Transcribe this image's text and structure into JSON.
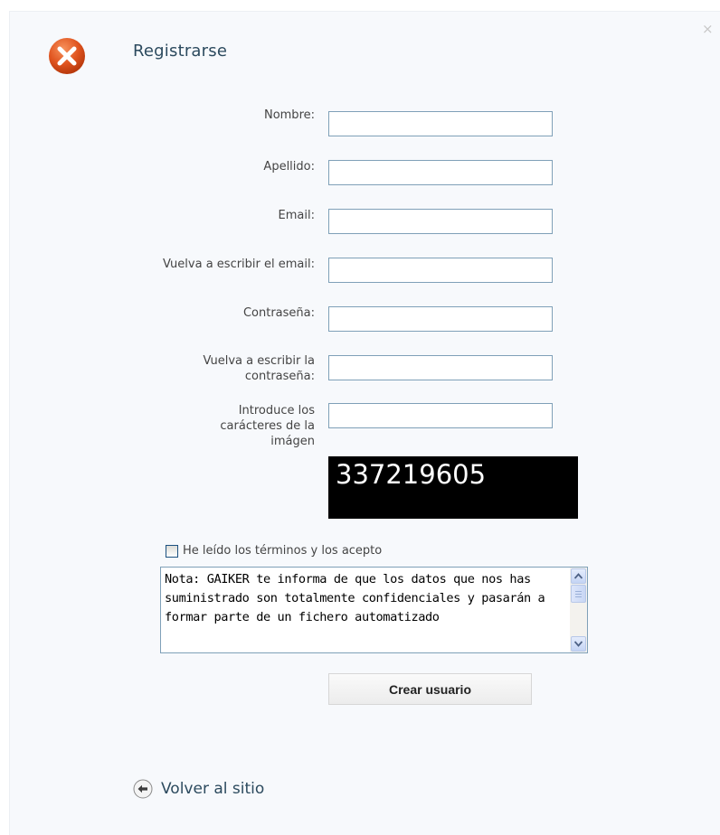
{
  "dialog": {
    "title": "Registrarse",
    "close_glyph": "×",
    "icons": {
      "status": "error-icon",
      "close": "close-icon",
      "back": "back-arrow-icon"
    },
    "colors": {
      "error_red": "#e0541f",
      "title_blue": "#2c4a5e",
      "field_border": "#7fa0b8"
    }
  },
  "form": {
    "fields": [
      {
        "label": "Nombre:",
        "value": ""
      },
      {
        "label": "Apellido:",
        "value": ""
      },
      {
        "label": "Email:",
        "value": ""
      },
      {
        "label": "Vuelva a escribir el email:",
        "value": ""
      },
      {
        "label": "Contraseña:",
        "value": ""
      },
      {
        "label": "Vuelva a escribir la contraseña:",
        "value": ""
      },
      {
        "label": "Introduce los carácteres de la imágen",
        "value": ""
      }
    ],
    "captcha_text": "337219605",
    "terms": {
      "label": "He leído los términos y los acepto",
      "checked": false
    },
    "note_text": "Nota: GAIKER te informa de que los datos que nos has suministrado son totalmente confidenciales y pasarán a formar parte de un fichero automatizado",
    "submit_label": "Crear usuario"
  },
  "footer": {
    "back_label": "Volver al sitio"
  }
}
